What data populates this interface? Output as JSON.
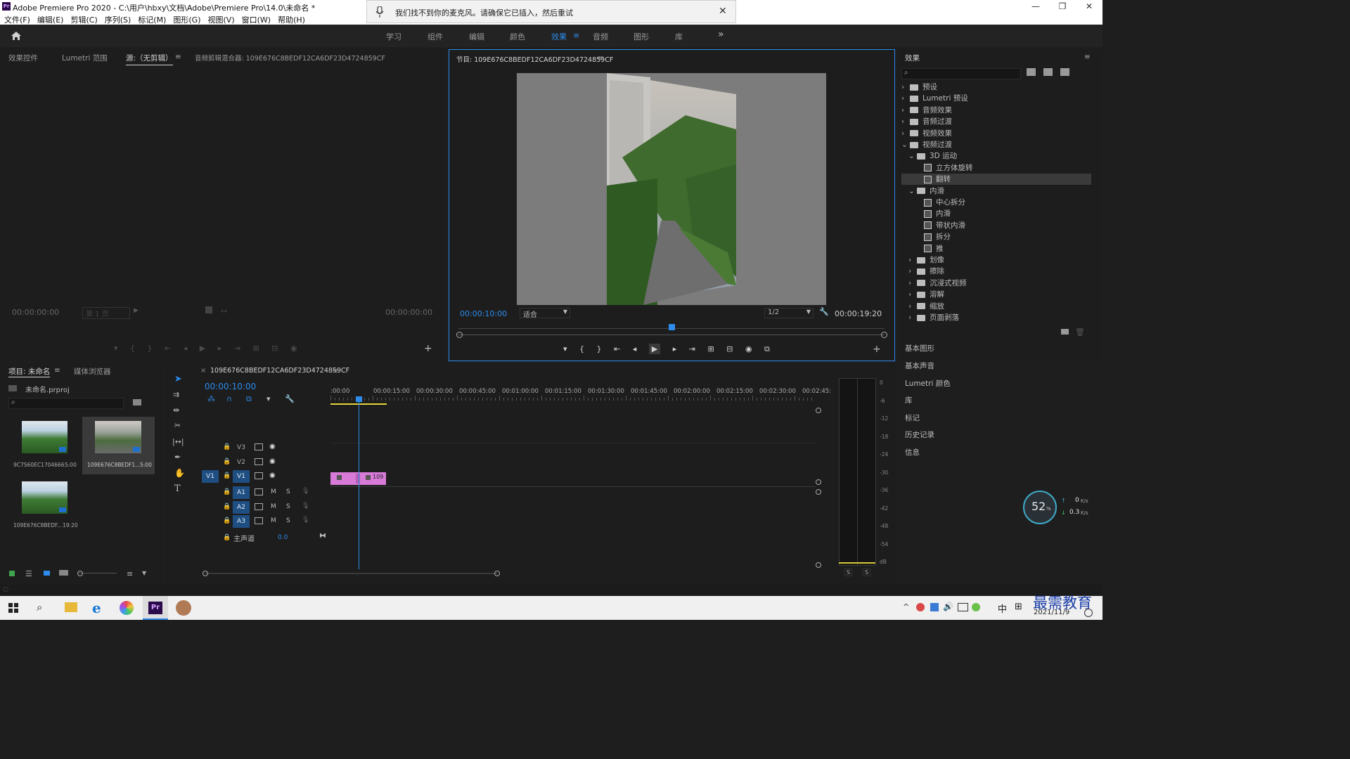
{
  "app": {
    "title": "Adobe Premiere Pro 2020 - C:\\用户\\hbxy\\文档\\Adobe\\Premiere Pro\\14.0\\未命名 *",
    "logo": "Pr",
    "menus": [
      "文件(F)",
      "编辑(E)",
      "剪辑(C)",
      "序列(S)",
      "标记(M)",
      "图形(G)",
      "视图(V)",
      "窗口(W)",
      "帮助(H)"
    ],
    "window_controls": [
      "—",
      "❐",
      "✕"
    ]
  },
  "notification": {
    "text": "我们找不到你的麦克风。请确保它已插入，然后重试",
    "close": "✕"
  },
  "workspaces": {
    "tabs": [
      {
        "label": "学习",
        "active": false
      },
      {
        "label": "组件",
        "active": false
      },
      {
        "label": "编辑",
        "active": false
      },
      {
        "label": "颜色",
        "active": false
      },
      {
        "label": "效果",
        "active": true
      },
      {
        "label": "音频",
        "active": false
      },
      {
        "label": "图形",
        "active": false
      },
      {
        "label": "库",
        "active": false
      }
    ],
    "more": "»",
    "menu": "≡"
  },
  "source_panel": {
    "tabs": [
      "效果控件",
      "Lumetri 范围",
      "源:（无剪辑）",
      "音频剪辑混合器: 109E676C8BEDF12CA6DF23D4724859CF"
    ],
    "menu": "≡",
    "timecode_left": "00:00:00:00",
    "page": "第 1 页",
    "timecode_right": "00:00:00:00"
  },
  "program_panel": {
    "title": "节目: 109E676C8BEDF12CA6DF23D4724859CF",
    "menu": "≡",
    "timecode": "00:00:10:00",
    "fit": "适合",
    "resolution": "1/2",
    "duration": "00:00:19:20"
  },
  "effects_panel": {
    "title": "效果",
    "menu": "≡",
    "search_placeholder": "",
    "tree": [
      {
        "label": "预设",
        "type": "folder",
        "depth": 0,
        "expanded": false
      },
      {
        "label": "Lumetri 预设",
        "type": "folder",
        "depth": 0,
        "expanded": false
      },
      {
        "label": "音频效果",
        "type": "folder",
        "depth": 0,
        "expanded": false
      },
      {
        "label": "音频过渡",
        "type": "folder",
        "depth": 0,
        "expanded": false
      },
      {
        "label": "视频效果",
        "type": "folder",
        "depth": 0,
        "expanded": false
      },
      {
        "label": "视频过渡",
        "type": "folder",
        "depth": 0,
        "expanded": true
      },
      {
        "label": "3D 运动",
        "type": "folder",
        "depth": 1,
        "expanded": true
      },
      {
        "label": "立方体旋转",
        "type": "effect",
        "depth": 2
      },
      {
        "label": "翻转",
        "type": "effect",
        "depth": 2,
        "selected": true
      },
      {
        "label": "内滑",
        "type": "folder",
        "depth": 1,
        "expanded": true
      },
      {
        "label": "中心拆分",
        "type": "effect",
        "depth": 2
      },
      {
        "label": "内滑",
        "type": "effect",
        "depth": 2
      },
      {
        "label": "带状内滑",
        "type": "effect",
        "depth": 2
      },
      {
        "label": "拆分",
        "type": "effect",
        "depth": 2
      },
      {
        "label": "推",
        "type": "effect",
        "depth": 2
      },
      {
        "label": "划像",
        "type": "folder",
        "depth": 1,
        "expanded": false
      },
      {
        "label": "擦除",
        "type": "folder",
        "depth": 1,
        "expanded": false
      },
      {
        "label": "沉浸式视频",
        "type": "folder",
        "depth": 1,
        "expanded": false
      },
      {
        "label": "溶解",
        "type": "folder",
        "depth": 1,
        "expanded": false
      },
      {
        "label": "缩放",
        "type": "folder",
        "depth": 1,
        "expanded": false
      },
      {
        "label": "页面剥落",
        "type": "folder",
        "depth": 1,
        "expanded": false
      }
    ],
    "side_sections": [
      "基本图形",
      "基本声音",
      "Lumetri 颜色",
      "库",
      "标记",
      "历史记录",
      "信息"
    ]
  },
  "project_panel": {
    "tabs": [
      "项目: 未命名",
      "媒体浏览器"
    ],
    "menu": "≡",
    "project_file": "未命名.prproj",
    "items": [
      {
        "name": "9C7S60EC1704666...",
        "duration": "5:00"
      },
      {
        "name": "109E676C8BEDF1...",
        "duration": "5:00",
        "selected": true
      },
      {
        "name": "109E676C8BEDF...",
        "duration": "19:20"
      }
    ]
  },
  "timeline": {
    "sequence_name": "109E676C8BEDF12CA6DF23D4724859CF",
    "menu": "≡",
    "timecode": "00:00:10:00",
    "ruler": [
      ":00:00",
      "00:00:15:00",
      "00:00:30:00",
      "00:00:45:00",
      "00:01:00:00",
      "00:01:15:00",
      "00:01:30:00",
      "00:01:45:00",
      "00:02:00:00",
      "00:02:15:00",
      "00:02:30:00",
      "00:02:45:"
    ],
    "video_tracks": [
      "V3",
      "V2",
      "V1"
    ],
    "audio_tracks": [
      "A1",
      "A2",
      "A3"
    ],
    "source_target": "V1",
    "master_label": "主声道",
    "master_value": "0.0",
    "clip_label": "109",
    "mute": "M",
    "solo": "S"
  },
  "audio_meter": {
    "scale": [
      "0",
      "-6",
      "-12",
      "-18",
      "-24",
      "-30",
      "-36",
      "-42",
      "-48",
      "-54",
      "dB"
    ],
    "solo_buttons": [
      "S",
      "S"
    ]
  },
  "net_widget": {
    "percent": "52",
    "unit": "%",
    "up": "0",
    "up_unit": "K/s",
    "down": "0.3",
    "down_unit": "K/s"
  },
  "taskbar": {
    "ime": "中",
    "date": "2021/11/9",
    "watermark": "最需教育"
  }
}
